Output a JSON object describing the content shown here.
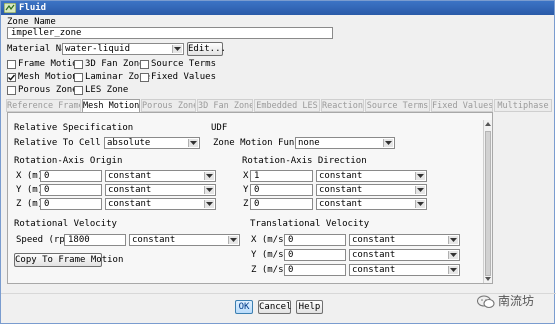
{
  "window": {
    "title": "Fluid"
  },
  "zone_name": {
    "label": "Zone Name",
    "value": "impeller_zone"
  },
  "material": {
    "label": "Material Name",
    "value": "water-liquid",
    "edit_label": "Edit..."
  },
  "options": [
    {
      "label": "Frame Motion",
      "checked": false
    },
    {
      "label": "3D Fan Zone",
      "checked": false
    },
    {
      "label": "Source Terms",
      "checked": false
    },
    {
      "label": "Mesh Motion",
      "checked": true
    },
    {
      "label": "Laminar Zone",
      "checked": false
    },
    {
      "label": "Fixed Values",
      "checked": false
    },
    {
      "label": "Porous Zone",
      "checked": false
    },
    {
      "label": "LES Zone",
      "checked": false
    }
  ],
  "tabs": [
    {
      "label": "Reference Frame",
      "active": false
    },
    {
      "label": "Mesh Motion",
      "active": true
    },
    {
      "label": "Porous Zone",
      "active": false
    },
    {
      "label": "3D Fan Zone",
      "active": false
    },
    {
      "label": "Embedded LES",
      "active": false
    },
    {
      "label": "Reaction",
      "active": false
    },
    {
      "label": "Source Terms",
      "active": false
    },
    {
      "label": "Fixed Values",
      "active": false
    },
    {
      "label": "Multiphase",
      "active": false
    }
  ],
  "relative_spec": {
    "heading": "Relative Specification",
    "label": "Relative To Cell Zone",
    "value": "absolute"
  },
  "udf": {
    "heading": "UDF",
    "label": "Zone Motion Function",
    "value": "none"
  },
  "rotation_origin": {
    "heading": "Rotation-Axis Origin",
    "rows": [
      {
        "label": "X (m)",
        "value": "0",
        "method": "constant"
      },
      {
        "label": "Y (m)",
        "value": "0",
        "method": "constant"
      },
      {
        "label": "Z (m)",
        "value": "0",
        "method": "constant"
      }
    ]
  },
  "rotation_direction": {
    "heading": "Rotation-Axis Direction",
    "rows": [
      {
        "label": "X",
        "value": "1",
        "method": "constant"
      },
      {
        "label": "Y",
        "value": "0",
        "method": "constant"
      },
      {
        "label": "Z",
        "value": "0",
        "method": "constant"
      }
    ]
  },
  "rotational_velocity": {
    "heading": "Rotational Velocity",
    "label": "Speed (rpm)",
    "value": "1800",
    "method": "constant"
  },
  "translational_velocity": {
    "heading": "Translational Velocity",
    "rows": [
      {
        "label": "X (m/s)",
        "value": "0",
        "method": "constant"
      },
      {
        "label": "Y (m/s)",
        "value": "0",
        "method": "constant"
      },
      {
        "label": "Z (m/s)",
        "value": "0",
        "method": "constant"
      }
    ]
  },
  "copy_button": "Copy To Frame Motion",
  "footer": {
    "ok": "OK",
    "cancel": "Cancel",
    "help": "Help"
  },
  "watermark": "南流坊",
  "colors": {
    "title_bar": "#2f63b4",
    "ok_border": "#3c7fb1"
  }
}
